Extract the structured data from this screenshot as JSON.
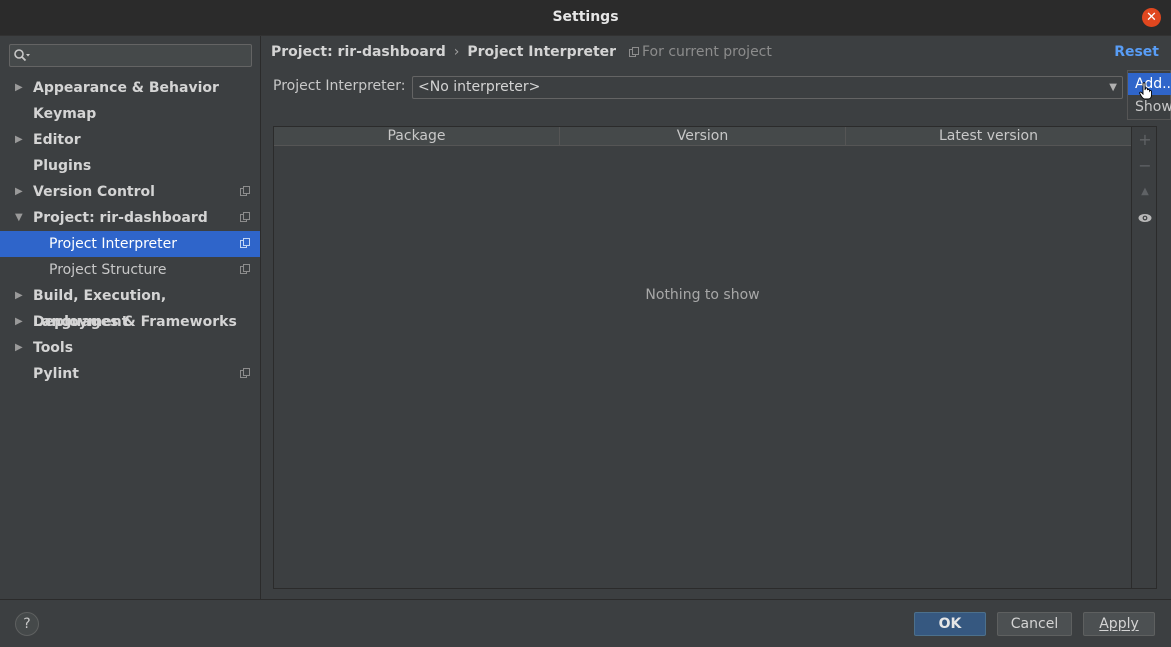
{
  "window": {
    "title": "Settings"
  },
  "search": {
    "placeholder": ""
  },
  "sidebar": {
    "items": [
      {
        "label": "Appearance & Behavior",
        "expandable": true
      },
      {
        "label": "Keymap",
        "expandable": false
      },
      {
        "label": "Editor",
        "expandable": true
      },
      {
        "label": "Plugins",
        "expandable": false
      },
      {
        "label": "Version Control",
        "expandable": true
      },
      {
        "label": "Project: rir-dashboard",
        "expandable": true,
        "expanded": true
      },
      {
        "label": "Project Interpreter",
        "child": true,
        "selected": true
      },
      {
        "label": "Project Structure",
        "child": true
      },
      {
        "label": "Build, Execution, Deployment",
        "expandable": true
      },
      {
        "label": "Languages & Frameworks",
        "expandable": true
      },
      {
        "label": "Tools",
        "expandable": true
      },
      {
        "label": "Pylint",
        "expandable": false
      }
    ]
  },
  "breadcrumb": {
    "project": "Project: rir-dashboard",
    "separator": "›",
    "page": "Project Interpreter"
  },
  "for_current_project": "For current project",
  "reset_label": "Reset",
  "interpreter": {
    "label": "Project Interpreter:",
    "value": "<No interpreter>"
  },
  "popup": {
    "items": [
      "Add...",
      "Show All..."
    ]
  },
  "table": {
    "columns": [
      "Package",
      "Version",
      "Latest version"
    ],
    "empty_text": "Nothing to show"
  },
  "footer": {
    "help": "?",
    "ok": "OK",
    "cancel": "Cancel",
    "apply": "Apply"
  },
  "colors": {
    "accent": "#2f65ca",
    "link": "#589df6",
    "close": "#e0471f",
    "ok_button": "#365880"
  }
}
